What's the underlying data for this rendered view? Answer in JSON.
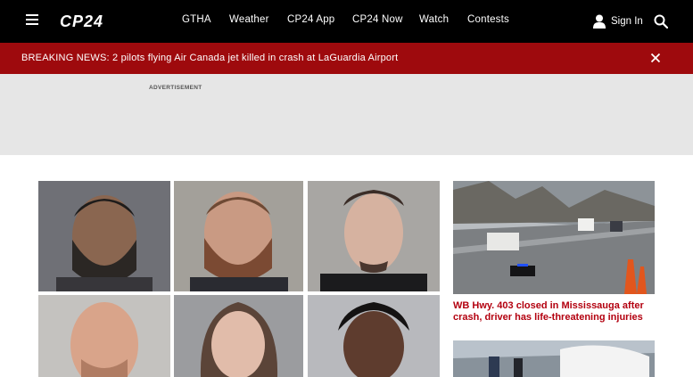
{
  "header": {
    "logo_text": "CP24",
    "menu_icon": "hamburger-icon",
    "nav": [
      "GTHA",
      "Weather",
      "CP24 App",
      "CP24 Now",
      "Watch",
      "Contests"
    ],
    "sign_in_label": "Sign In",
    "user_icon": "user-icon",
    "search_icon": "search-icon"
  },
  "breaking": {
    "text": "BREAKING NEWS: 2 pilots flying Air Canada jet killed in crash at LaGuardia Airport",
    "close_icon": "close-icon",
    "color": "#9e0a0d"
  },
  "ad": {
    "label": "ADVERTISEMENT"
  },
  "stories": [
    {
      "title": "WB Hwy. 403 closed in Mississauga after crash, driver has life-threatening injuries"
    }
  ],
  "colors": {
    "topbar": "#000000",
    "headline": "#b3000f",
    "ad_bg": "#e6e6e6"
  }
}
